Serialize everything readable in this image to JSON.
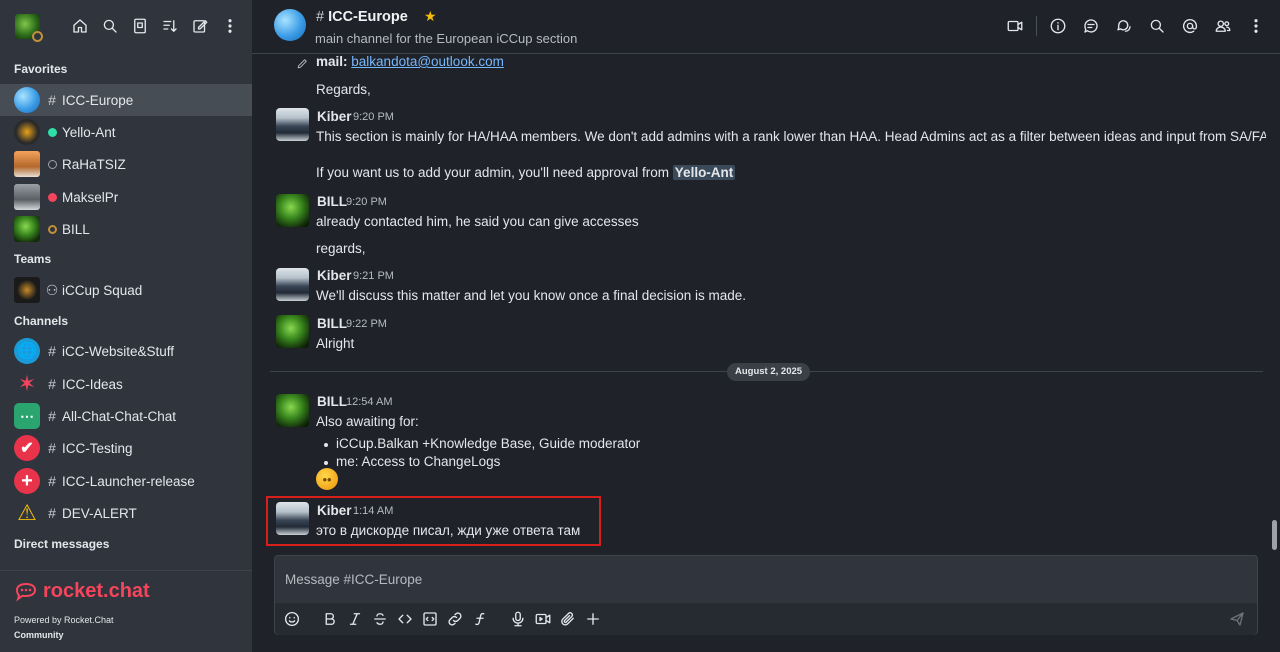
{
  "sidebar": {
    "sections": {
      "favorites": "Favorites",
      "teams": "Teams",
      "channels": "Channels",
      "direct": "Direct messages"
    },
    "favorites": [
      {
        "label": "ICC-Europe",
        "prefix": "hash",
        "active": true
      },
      {
        "label": "Yello-Ant",
        "prefix": "status-online",
        "status_color": "#2de0a5"
      },
      {
        "label": "RaHaTSIZ",
        "prefix": "status-offline",
        "status_color": "#9ea2a8"
      },
      {
        "label": "MakselPr",
        "prefix": "status-busy",
        "status_color": "#f5455c"
      },
      {
        "label": "BILL",
        "prefix": "status-away",
        "status_color": "#c1903a"
      }
    ],
    "teams": [
      {
        "label": "iCCup Squad",
        "prefix": "team"
      }
    ],
    "channels": [
      {
        "label": "iCC-Website&Stuff",
        "prefix": "hash"
      },
      {
        "label": "ICC-Ideas",
        "prefix": "hash"
      },
      {
        "label": "All-Chat-Chat-Chat",
        "prefix": "hash"
      },
      {
        "label": "ICC-Testing",
        "prefix": "hash"
      },
      {
        "label": "ICC-Launcher-release",
        "prefix": "hash"
      },
      {
        "label": "DEV-ALERT",
        "prefix": "hash"
      }
    ],
    "footer": {
      "brand": "rocket.chat",
      "powered": "Powered by Rocket.Chat",
      "edition": "Community"
    }
  },
  "header": {
    "title": "ICC-Europe",
    "topic": "main channel for the European iCCup section",
    "favorite": true
  },
  "messages": {
    "m0_label": "mail:",
    "m0_link": "balkandota@outlook.com",
    "m0_regards": "Regards,",
    "kiber1": {
      "user": "Kiber",
      "time": "9:20 PM",
      "line1": "This section is mainly for HA/HAA members. We don't add admins with a rank lower than HAA. Head Admins act as a filter between ideas and input from SA/FA.",
      "line2": "If you want us to add your admin, you'll need approval from",
      "mention": "Yello-Ant"
    },
    "bill1": {
      "user": "BILL",
      "time": "9:20 PM",
      "line1": "already contacted him, he said you can give accesses",
      "line2": "regards,"
    },
    "kiber2": {
      "user": "Kiber",
      "time": "9:21 PM",
      "line1": "We'll discuss this matter and let you know once a final decision is made."
    },
    "bill2": {
      "user": "BILL",
      "time": "9:22 PM",
      "line1": "Alright"
    },
    "date_divider": "August 2, 2025",
    "bill3": {
      "user": "BILL",
      "time": "12:54 AM",
      "line1": "Also awaiting for:",
      "bullets": [
        "iCCup.Balkan +Knowledge Base, Guide moderator",
        "me: Access to ChangeLogs"
      ],
      "emoji": "thinking-emoji"
    },
    "kiber3": {
      "user": "Kiber",
      "time": "1:14 AM",
      "line1": "это в дискорде писал, жди уже ответа там"
    }
  },
  "composer": {
    "placeholder": "Message #ICC-Europe"
  },
  "colors": {
    "highlight": "#d91e1e",
    "accent": "#f5455c",
    "link": "#76b7fc",
    "star": "#f3be08"
  }
}
